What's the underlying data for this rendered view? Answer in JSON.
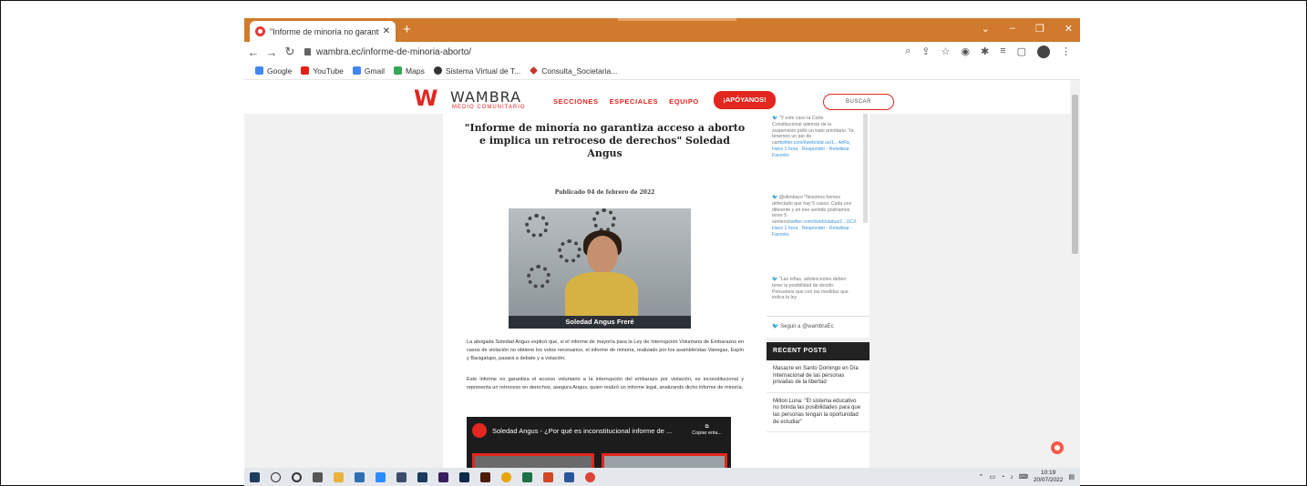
{
  "browser": {
    "tab_title": "\"Informe de minoría no garantiza",
    "url": "wambra.ec/informe-de-minoria-aborto/",
    "bookmarks": [
      "Google",
      "YouTube",
      "Gmail",
      "Maps",
      "Sistema Virtual de T...",
      "Consulta_Societaria..."
    ]
  },
  "site": {
    "logo": "WAMBRA",
    "logo_sub": "MEDIO COMUNITARIO",
    "nav": [
      "SECCIONES",
      "ESPECIALES",
      "EQUIPO"
    ],
    "support_button": "¡APÓYANOS!",
    "search_button": "BUSCAR"
  },
  "article": {
    "title": "\"Informe de minoría no garantiza acceso a aborto e implica un retroceso de derechos\" Soledad Angus",
    "published": "Publicado 04 de febrero de 2022",
    "photo_caption": "Soledad Angus Freré",
    "paragraph1": "La abogada Soledad Angus explicó que, si el informe de mayoría para la Ley de Interrupción Voluntaria de Embarazos en casos de violación no obtiene los votos necesarios, el informe de minoría, realizado por los asambleístas Vanegas, Espín y Bacigalupo, pasará a debate y a votación.",
    "paragraph2": "Este informe no garantiza el acceso voluntario a la interrupción del embarazo por violación, es inconstitucional y representa un retroceso en derechos, asegura Angus, quien realizó un informe legal, analizando dicho informe de minoría.",
    "video_title": "Soledad Angus - ¿Por qué es inconstitucional informe de ...",
    "video_copy": "Copiar enla..."
  },
  "sidebar": {
    "tweets": [
      {
        "text": "\"Y este caso la Corte Constitucional además de la suspensión pidió un trato prioritario. Ya tenemos un par de cart",
        "link": "twitter.com/i/web/stat us/1...4eRq",
        "actions": "Hace 1 hora · Responder · Retwitear · Favorito"
      },
      {
        "text": "@olimbaco \"Nosotros hemos detectado que hay 5 casos. Cada uno diferente y en ese sentido podríamos tener 5 sentenci",
        "link": "twitter.com/i/web/status/1...UCX",
        "actions": "Hace 1 hora · Responder · Retwitear · Favorito"
      },
      {
        "text": "\"Las niñas, adolescentes deben tener la posibilidad de decidir. Pensamos que con las medidas que indica la ley",
        "link": "",
        "actions": ""
      }
    ],
    "follow": "Seguir a @wambraEc",
    "recent_heading": "RECENT POSTS",
    "recent_posts": [
      "Masacre en Santo Domingo en Día Internacional de las personas privadas de la libertad",
      "Milton Luna: \"El sistema educativo no brinda las posibilidades para que las personas tengan la oportunidad de estudiar\""
    ]
  },
  "taskbar": {
    "time": "10:19",
    "date": "20/07/2022"
  }
}
